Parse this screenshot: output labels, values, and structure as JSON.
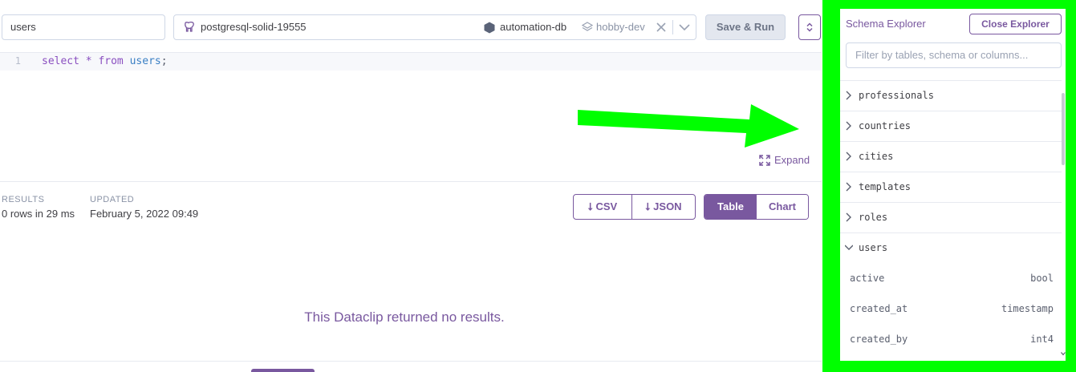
{
  "header": {
    "title_value": "users",
    "database": "postgresql-solid-19555",
    "app": "automation-db",
    "plan": "hobby-dev",
    "save_run_label": "Save & Run"
  },
  "editor": {
    "line_number": "1",
    "code": {
      "kw1": "select",
      "op": "*",
      "kw2": "from",
      "table": "users",
      "end": ";"
    },
    "expand_label": "Expand"
  },
  "results": {
    "results_label": "RESULTS",
    "results_value": "0 rows in 29 ms",
    "updated_label": "UPDATED",
    "updated_value": "February 5, 2022 09:49",
    "csv_label": "CSV",
    "json_label": "JSON",
    "table_label": "Table",
    "chart_label": "Chart",
    "empty_message": "This Dataclip returned no results."
  },
  "explorer": {
    "title": "Schema Explorer",
    "close_label": "Close Explorer",
    "filter_placeholder": "Filter by tables, schema or columns...",
    "tables": [
      {
        "name": "professionals",
        "expanded": false
      },
      {
        "name": "countries",
        "expanded": false
      },
      {
        "name": "cities",
        "expanded": false
      },
      {
        "name": "templates",
        "expanded": false
      },
      {
        "name": "roles",
        "expanded": false
      },
      {
        "name": "users",
        "expanded": true
      }
    ],
    "columns": [
      {
        "name": "active",
        "type": "bool"
      },
      {
        "name": "created_at",
        "type": "timestamp"
      },
      {
        "name": "created_by",
        "type": "int4"
      }
    ]
  },
  "colors": {
    "accent": "#79589f",
    "highlight_frame": "#00ff00",
    "annotation_arrow": "#00ff00"
  },
  "icons": [
    "postgres-elephant-icon",
    "hexagon-icon",
    "layers-icon",
    "clear-x-icon",
    "chevron-down-icon",
    "up-down-chevron-icon",
    "expand-arrows-icon",
    "download-arrow-icon",
    "chevron-right-icon"
  ]
}
